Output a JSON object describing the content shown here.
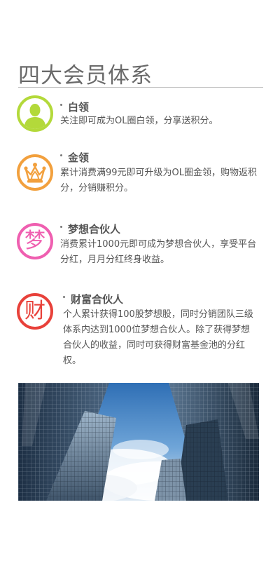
{
  "page_title": "四大会员体系",
  "tiers": [
    {
      "name": "白领",
      "icon": "person-icon",
      "color": "#b3d93a",
      "description": "关注即可成为OL圈白领，分享送积分。"
    },
    {
      "name": "金领",
      "icon": "crown-icon",
      "color": "#f2a03d",
      "description": "累计消费满99元即可升级为OL圈金领，购物返积分，分销赚积分。"
    },
    {
      "name": "梦想合伙人",
      "icon": "dream-char-icon",
      "icon_char": "梦",
      "color": "#ef5fb0",
      "description": "消费累计1000元即可成为梦想合伙人，享受平台分红，月月分红终身收益。"
    },
    {
      "name": "财富合伙人",
      "icon": "wealth-char-icon",
      "icon_char": "财",
      "color": "#e8413a",
      "description": "个人累计获得100股梦想股，同时分销团队三级体系内达到1000位梦想合伙人。除了获得梦想合伙人的收益，同时可获得财富基金池的分红权。"
    }
  ],
  "banner": {
    "icon": "skyscrapers-image"
  }
}
